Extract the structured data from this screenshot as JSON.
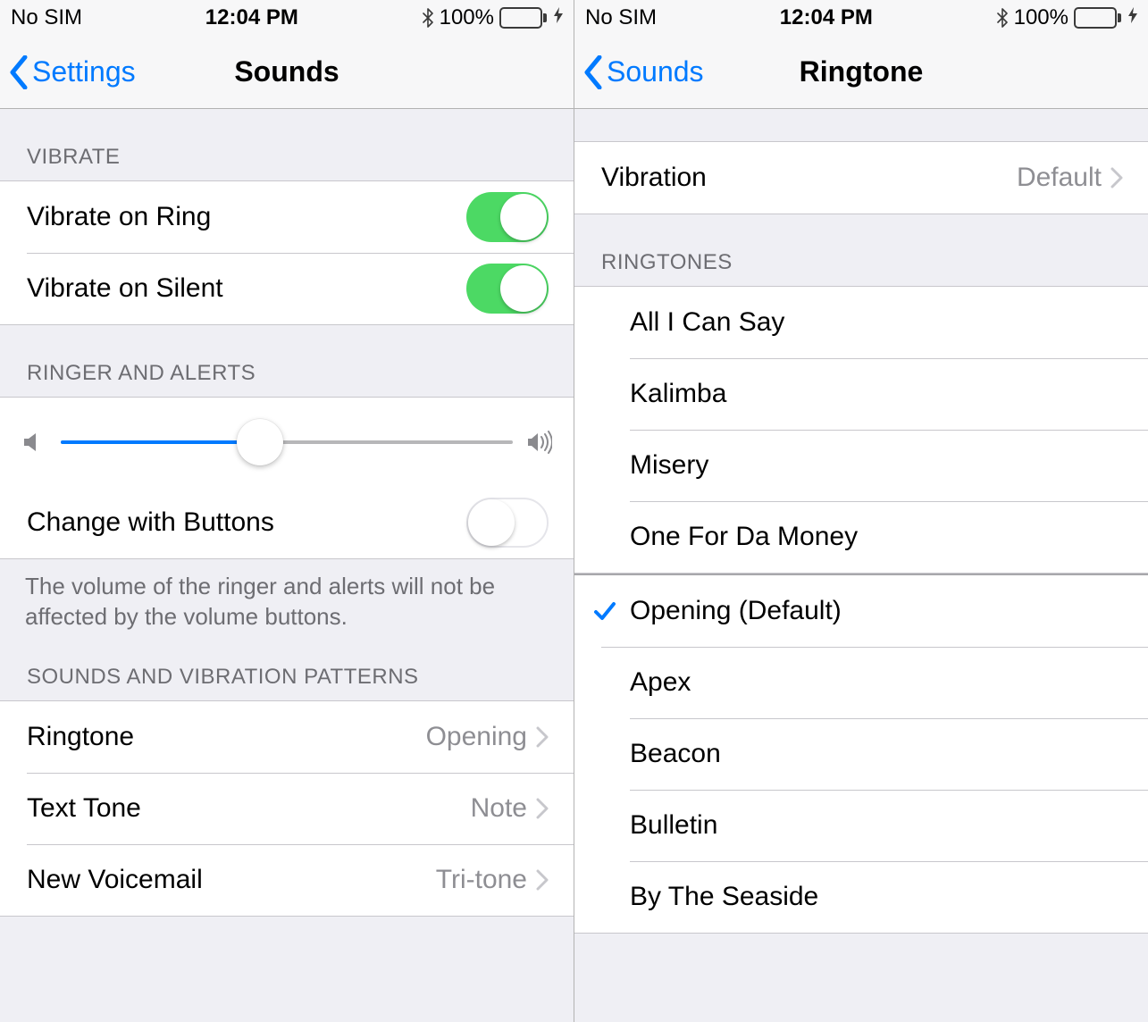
{
  "status": {
    "carrier": "No SIM",
    "time": "12:04 PM",
    "battery_pct": "100%"
  },
  "left": {
    "back_label": "Settings",
    "title": "Sounds",
    "sections": {
      "vibrate_header": "VIBRATE",
      "vibrate_ring": "Vibrate on Ring",
      "vibrate_silent": "Vibrate on Silent",
      "ringer_header": "RINGER AND ALERTS",
      "change_buttons": "Change with Buttons",
      "footer_text": "The volume of the ringer and alerts will not be affected by the volume buttons.",
      "sounds_header": "SOUNDS AND VIBRATION PATTERNS",
      "items": [
        {
          "label": "Ringtone",
          "value": "Opening"
        },
        {
          "label": "Text Tone",
          "value": "Note"
        },
        {
          "label": "New Voicemail",
          "value": "Tri-tone"
        }
      ]
    },
    "toggles": {
      "vibrate_ring": true,
      "vibrate_silent": true,
      "change_buttons": false
    },
    "slider_pct": 44
  },
  "right": {
    "back_label": "Sounds",
    "title": "Ringtone",
    "vibration_label": "Vibration",
    "vibration_value": "Default",
    "ringtones_header": "RINGTONES",
    "custom_tones": [
      "All I Can Say",
      "Kalimba",
      "Misery",
      "One For Da Money"
    ],
    "selected": "Opening (Default)",
    "builtin": [
      "Apex",
      "Beacon",
      "Bulletin",
      "By The Seaside"
    ]
  },
  "colors": {
    "link": "#007aff",
    "toggle_on": "#4cd964",
    "secondary_text": "#8e8e93",
    "group_bg": "#efeff4"
  }
}
